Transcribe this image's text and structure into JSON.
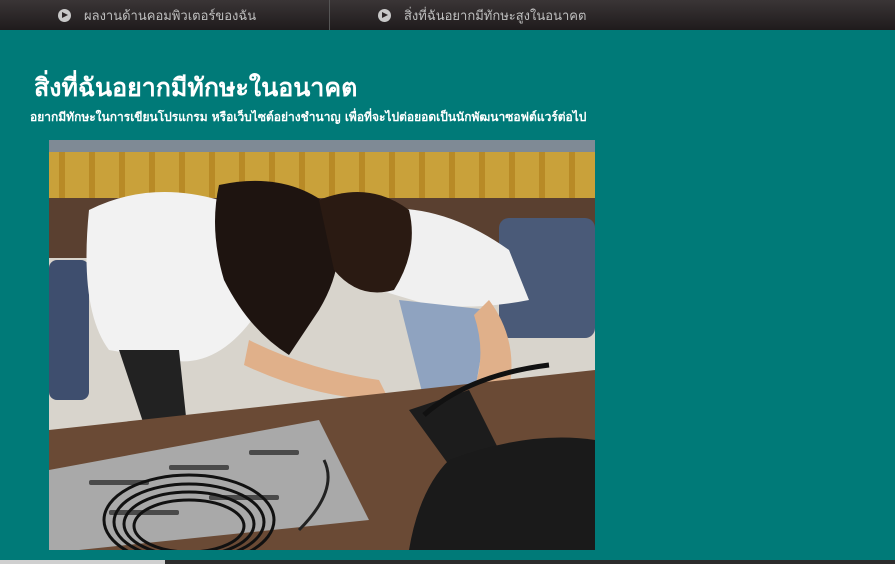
{
  "nav": {
    "items": [
      {
        "label": "ผลงานด้านคอมพิวเตอร์ของฉัน",
        "icon": "arrow-circle-right-icon"
      },
      {
        "label": "สิ่งที่ฉันอยากมีทักษะสูงในอนาคต",
        "icon": "arrow-circle-right-icon"
      }
    ]
  },
  "main": {
    "title": "สิ่งที่ฉันอยากมีทักษะในอนาคต",
    "subtitle": "อยากมีทักษะในการเขียนโปรแกรม หรือเว็บไซต์อย่างชำนาญ เพื่อที่จะไปต่อยอดเป็นนักพัฒนาซอฟต์แวร์ต่อไป"
  },
  "colors": {
    "background": "#007a78",
    "nav_background": "#2a2526",
    "nav_text": "#bfbfbf",
    "text": "#ffffff"
  }
}
